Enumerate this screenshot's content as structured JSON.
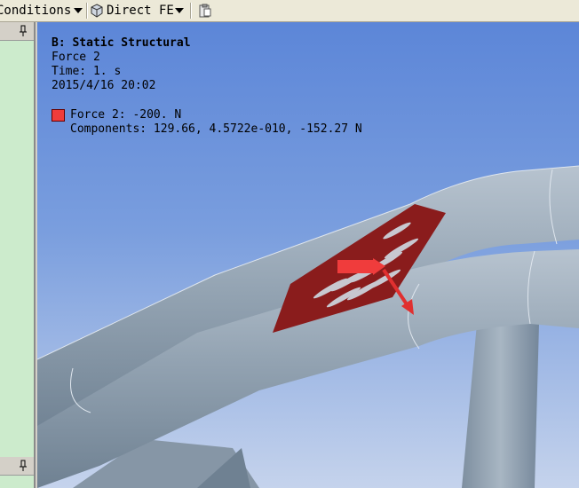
{
  "toolbar": {
    "conditions_label": "Conditions",
    "direct_fe_label": "Direct FE"
  },
  "viewport": {
    "analysis_title": "B: Static Structural",
    "object_name": "Force 2",
    "time_text": "Time: 1. s",
    "date_text": "2015/4/16 20:02",
    "legend_force": "Force 2: -200. N",
    "legend_components": "Components: 129.66, 4.5722e-010, -152.27 N"
  },
  "colors": {
    "force_red": "#f03c3c",
    "tube_gray": "#93a3b2",
    "background_top": "#5c86d8",
    "background_bottom": "#c5d3ec"
  },
  "icons": [
    "cube-icon",
    "dropdown-arrow-icon",
    "clipboard-icon",
    "pin-icon"
  ]
}
